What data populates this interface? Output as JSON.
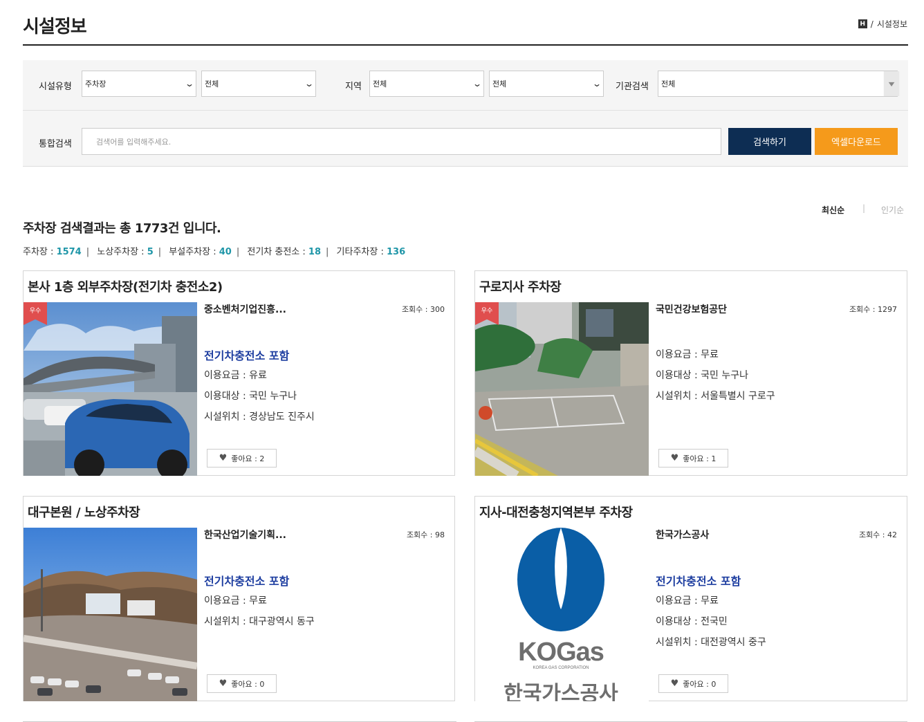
{
  "header": {
    "title": "시설정보",
    "home_icon_glyph": "H",
    "breadcrumb_current": "시설정보",
    "breadcrumb_sep": "/"
  },
  "filters": {
    "facility_type_label": "시설유형",
    "facility_type_value": "주차장",
    "facility_subtype_value": "전체",
    "region_label": "지역",
    "region_value": "전체",
    "region_sub_value": "전체",
    "org_label": "기관검색",
    "org_value": "전체",
    "search_label": "통합검색",
    "search_placeholder": "검색어를 입력해주세요.",
    "search_button": "검색하기",
    "excel_button": "엑셀다운로드"
  },
  "sort": {
    "latest": "최신순",
    "separator": "|",
    "popular": "인기순"
  },
  "summary": {
    "text": "주차장 검색결과는 총 1773건 입니다.",
    "counts": [
      {
        "label": "주차장 : ",
        "value": "1574"
      },
      {
        "label": "노상주차장 : ",
        "value": "5"
      },
      {
        "label": "부설주차장 : ",
        "value": "40"
      },
      {
        "label": "전기차 충전소 : ",
        "value": "18"
      },
      {
        "label": "기타주차장 : ",
        "value": "136"
      }
    ]
  },
  "cards": [
    {
      "title": "본사 1층 외부주차장(전기차 충전소2)",
      "org": "중소벤처기업진흥...",
      "views": "조회수 : 300",
      "badge": "우수",
      "ev": "전기차충전소 포함",
      "fee": "이용요금 : 유료",
      "target": "이용대상 : 국민 누구나",
      "location": "시설위치 : 경상남도 진주시",
      "likes": "좋아요 : 2"
    },
    {
      "title": "구로지사 주차장",
      "org": "국민건강보험공단",
      "views": "조회수 : 1297",
      "badge": "우수",
      "fee": "이용요금 : 무료",
      "target": "이용대상 : 국민 누구나",
      "location": "시설위치 : 서울특별시 구로구",
      "likes": "좋아요 : 1"
    },
    {
      "title": "대구본원 / 노상주차장",
      "org": "한국산업기술기획...",
      "views": "조회수 : 98",
      "ev": "전기차충전소 포함",
      "fee": "이용요금 : 무료",
      "location": "시설위치 : 대구광역시 동구",
      "likes": "좋아요 : 0"
    },
    {
      "title": "지사-대전충청지역본부 주차장",
      "org": "한국가스공사",
      "views": "조회수 : 42",
      "ev": "전기차충전소 포함",
      "fee": "이용요금 : 무료",
      "target": "이용대상 : 전국민",
      "location": "시설위치 : 대전광역시 중구",
      "likes": "좋아요 : 0",
      "logo_text": "KOGas",
      "logo_sub": "KOREA GAS CORPORATION",
      "logo_korean": "한국가스공사"
    }
  ],
  "colors": {
    "primary_button": "#0d2d53",
    "excel_button": "#f59a1b",
    "ev_text": "#1e3ea0",
    "count_num": "#1f96a8",
    "badge": "#e04e4e"
  },
  "icons": {
    "heart": "heart-icon",
    "chevron": "chevron-down-icon",
    "home": "home-icon"
  }
}
